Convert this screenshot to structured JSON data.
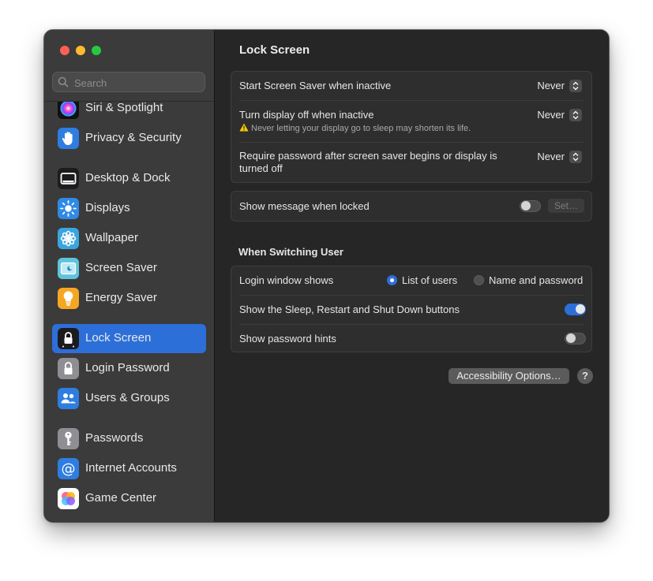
{
  "window": {
    "title": "Lock Screen"
  },
  "search": {
    "placeholder": "Search",
    "icon": "search-icon"
  },
  "sidebar": {
    "items": [
      {
        "label": "Siri & Spotlight",
        "icon": "siri-icon",
        "color": "#a33fd6"
      },
      {
        "label": "Privacy & Security",
        "icon": "hand-icon",
        "color": "#2f7de1"
      },
      {
        "label": "Desktop & Dock",
        "icon": "dock-icon",
        "color": "#1c1c1e"
      },
      {
        "label": "Displays",
        "icon": "sun-icon",
        "color": "#2f8ae6"
      },
      {
        "label": "Wallpaper",
        "icon": "flower-icon",
        "color": "#3aa6e0"
      },
      {
        "label": "Screen Saver",
        "icon": "screen-saver-icon",
        "color": "#5fc4dd"
      },
      {
        "label": "Energy Saver",
        "icon": "lightbulb-icon",
        "color": "#f5a623"
      },
      {
        "label": "Lock Screen",
        "icon": "lock-icon",
        "color": "#1c1c1e",
        "selected": true
      },
      {
        "label": "Login Password",
        "icon": "lock-icon",
        "color": "#8e8e93"
      },
      {
        "label": "Users & Groups",
        "icon": "users-icon",
        "color": "#2f7de1"
      },
      {
        "label": "Passwords",
        "icon": "key-icon",
        "color": "#8e8e93"
      },
      {
        "label": "Internet Accounts",
        "icon": "at-icon",
        "color": "#2f7de1"
      },
      {
        "label": "Game Center",
        "icon": "game-center-icon",
        "color": "#ffffff"
      }
    ]
  },
  "main": {
    "title": "Lock Screen",
    "timing": {
      "screen_saver": {
        "label": "Start Screen Saver when inactive",
        "value": "Never"
      },
      "display_off": {
        "label": "Turn display off when inactive",
        "value": "Never",
        "warning": "Never letting your display go to sleep may shorten its life."
      },
      "require_password": {
        "label": "Require password after screen saver begins or display is turned off",
        "value": "Never"
      }
    },
    "message": {
      "label": "Show message when locked",
      "enabled": false,
      "button": "Set…"
    },
    "switching": {
      "heading": "When Switching User",
      "login_window": {
        "label": "Login window shows",
        "options": [
          "List of users",
          "Name and password"
        ],
        "selected": "List of users"
      },
      "sleep_buttons": {
        "label": "Show the Sleep, Restart and Shut Down buttons",
        "enabled": true
      },
      "password_hints": {
        "label": "Show password hints",
        "enabled": false
      }
    },
    "accessibility_button": "Accessibility Options…",
    "help_button": "?"
  },
  "colors": {
    "accent": "#2d6fd9",
    "sidebar_bg": "#3b3b3c",
    "content_bg": "#262626",
    "warning": "#ffcc00"
  }
}
